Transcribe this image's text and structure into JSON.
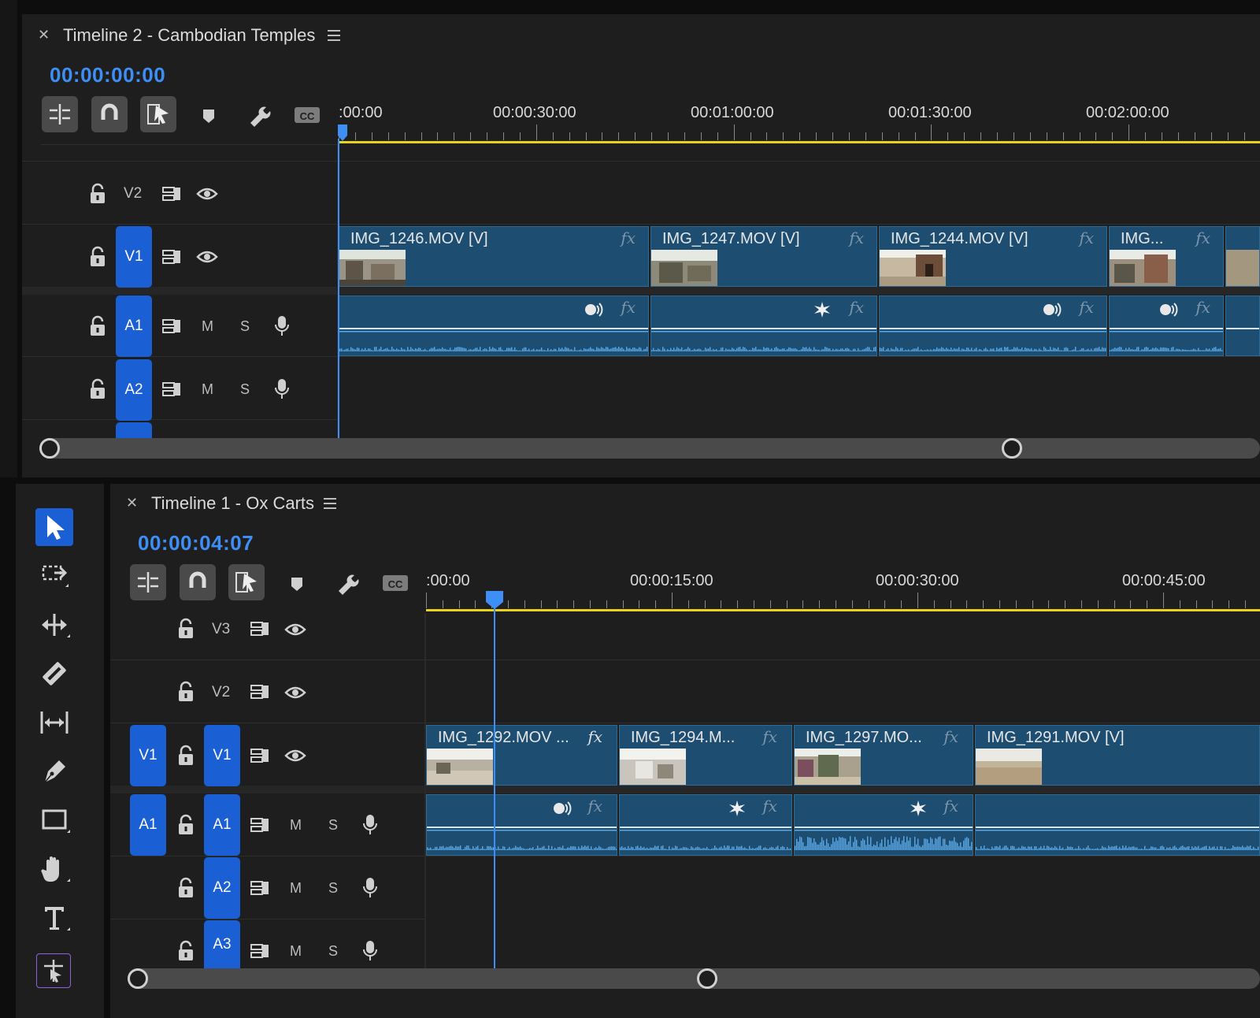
{
  "timeline2": {
    "title": "Timeline 2 - Cambodian Temples",
    "timecode": "00:00:00:00",
    "ruler": [
      ":00:00",
      "00:00:30:00",
      "00:01:00:00",
      "00:01:30:00",
      "00:02:00:00"
    ],
    "tracks": {
      "v2": "V2",
      "v1": "V1",
      "a1": "A1",
      "a2": "A2",
      "m": "M",
      "s": "S"
    },
    "video_clips": [
      "IMG_1246.MOV [V]",
      "IMG_1247.MOV [V]",
      "IMG_1244.MOV [V]",
      "IMG..."
    ],
    "fx": "fx"
  },
  "timeline1": {
    "title": "Timeline 1 - Ox Carts",
    "timecode": "00:00:04:07",
    "ruler": [
      ":00:00",
      "00:00:15:00",
      "00:00:30:00",
      "00:00:45:00"
    ],
    "tracks": {
      "v3": "V3",
      "v2": "V2",
      "v1": "V1",
      "a1": "A1",
      "a2": "A2",
      "a3": "A3",
      "src_v1": "V1",
      "src_a1": "A1",
      "m": "M",
      "s": "S"
    },
    "video_clips": [
      "IMG_1292.MOV ...",
      "IMG_1294.M...",
      "IMG_1297.MO...",
      "IMG_1291.MOV [V]"
    ],
    "fx": "fx"
  },
  "colors": {
    "accent": "#3e8ff5",
    "track_target": "#1a5fd4",
    "clip": "#1d4d70",
    "work_area": "#e8d21d",
    "panel": "#1e1e1e"
  },
  "icons": {
    "tools": [
      "selection-tool-icon",
      "track-select-icon",
      "ripple-edit-icon",
      "razor-icon",
      "slip-icon",
      "pen-icon",
      "rectangle-icon",
      "hand-icon",
      "type-icon",
      "extra-tool-icon"
    ]
  }
}
